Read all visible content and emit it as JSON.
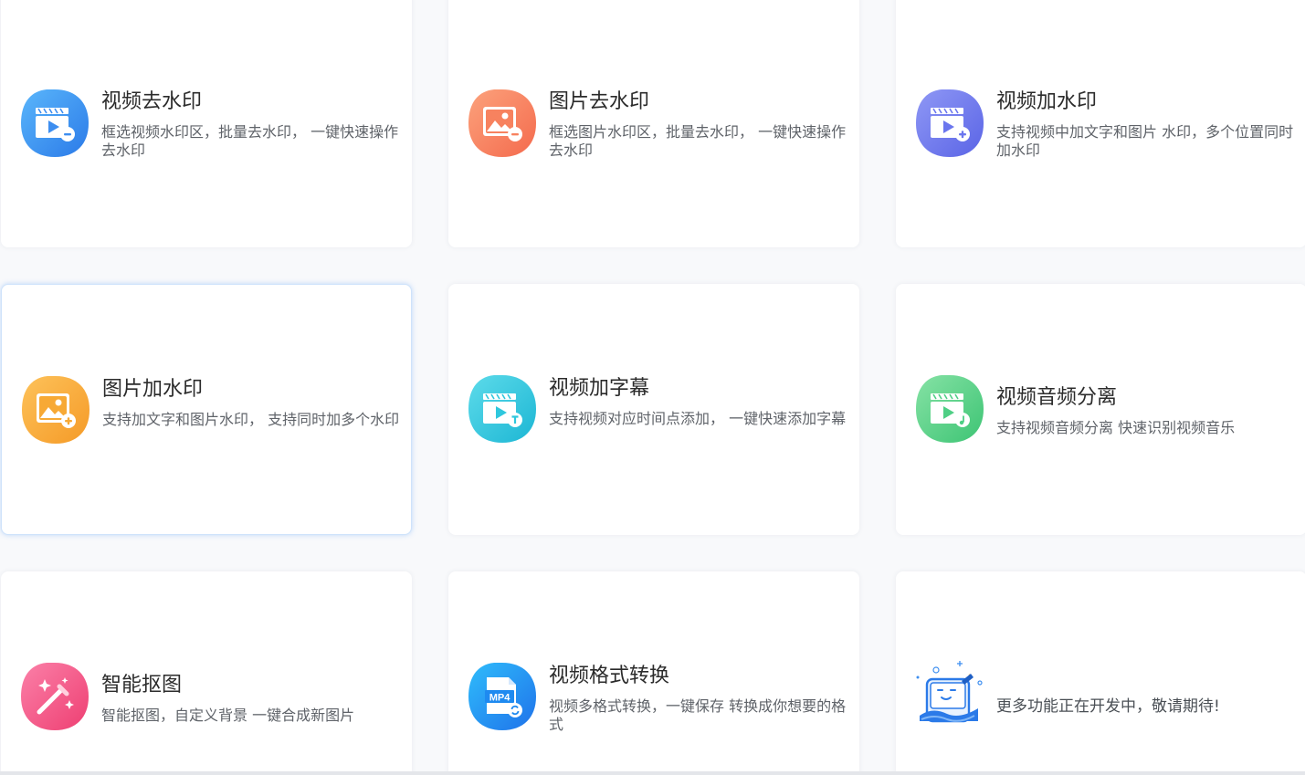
{
  "features": [
    {
      "title": "视频去水印",
      "desc": "框选视频水印区，批量去水印，  一键快速操作去水印",
      "icon": "video-remove-watermark-icon",
      "color": "#3d8ef0"
    },
    {
      "title": "图片去水印",
      "desc": "框选图片水印区，批量去水印，  一键快速操作去水印",
      "icon": "image-remove-watermark-icon",
      "color": "#f7825f"
    },
    {
      "title": "视频加水印",
      "desc": "支持视频中加文字和图片 水印，多个位置同时加水印",
      "icon": "video-add-watermark-icon",
      "color": "#6b76ee"
    },
    {
      "title": "图片加水印",
      "desc": "支持加文字和图片水印，  支持同时加多个水印",
      "icon": "image-add-watermark-icon",
      "color": "#f7a935"
    },
    {
      "title": "视频加字幕",
      "desc": "支持视频对应时间点添加，  一键快速添加字幕",
      "icon": "video-subtitle-icon",
      "color": "#2ec7dd"
    },
    {
      "title": "视频音频分离",
      "desc": "支持视频音频分离 快速识别视频音乐",
      "icon": "audio-separate-icon",
      "color": "#4fcf85"
    },
    {
      "title": "智能抠图",
      "desc": "智能抠图，自定义背景 一键合成新图片",
      "icon": "magic-wand-icon",
      "color": "#f25485"
    },
    {
      "title": "视频格式转换",
      "desc": "视频多格式转换，一键保存 转换成你想要的格式",
      "icon": "mp4-convert-icon",
      "color": "#1e8af0",
      "icon_text": "MP4"
    }
  ],
  "more": {
    "text": "更多功能正在开发中，敬请期待!",
    "icon": "in-development-illustration-icon"
  }
}
